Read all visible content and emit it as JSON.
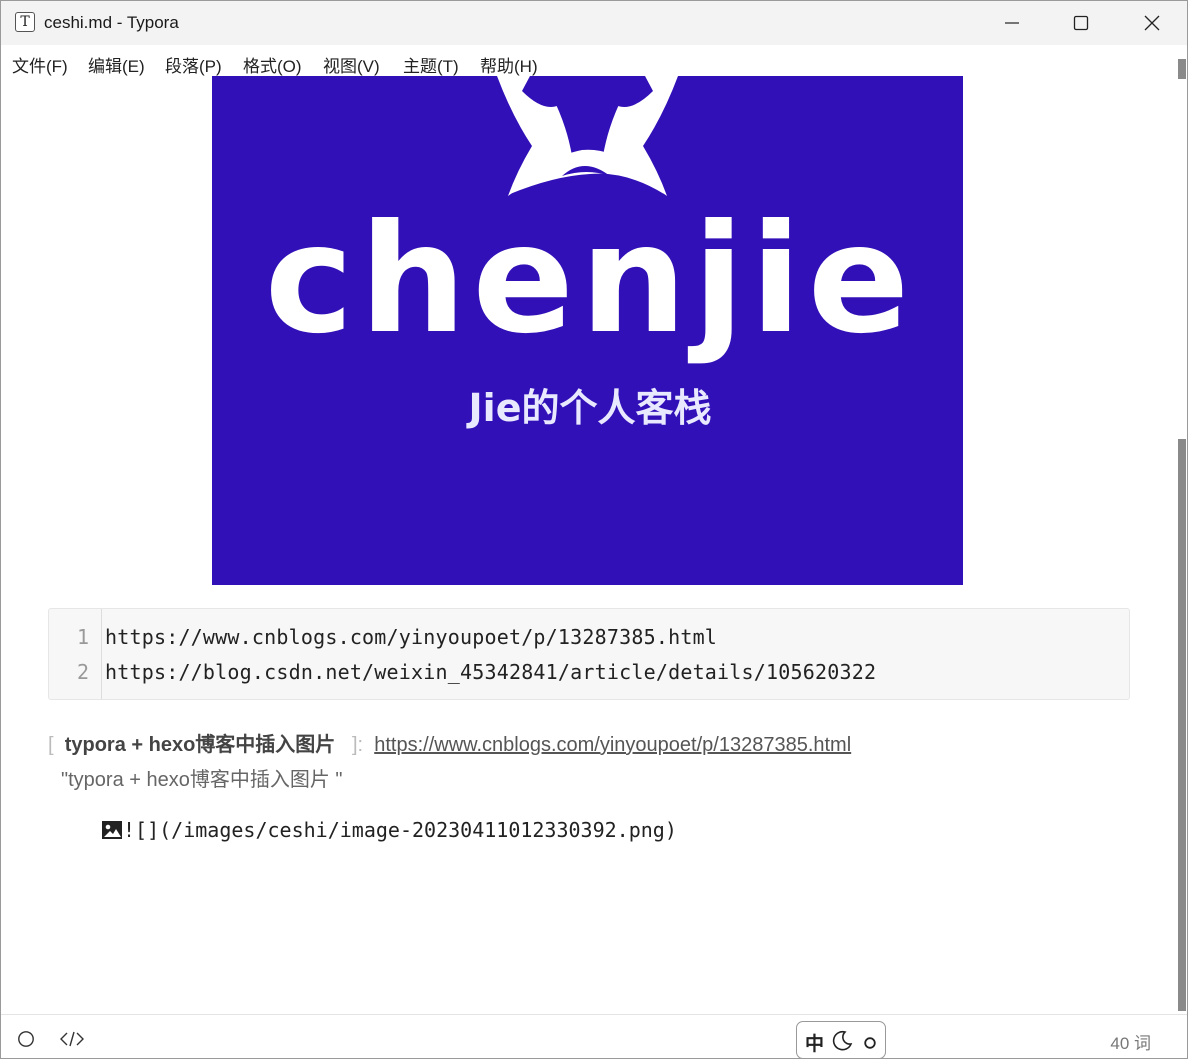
{
  "window": {
    "title": "ceshi.md - Typora",
    "app_icon_letter": "T"
  },
  "menu": [
    "文件(F)",
    "编辑(E)",
    "段落(P)",
    "格式(O)",
    "视图(V)",
    "主题(T)",
    "帮助(H)"
  ],
  "banner": {
    "logo_text": "chenjie",
    "subtitle": "Jie的个人客栈",
    "background_color": "#3210b8"
  },
  "code_block": {
    "lines": [
      {
        "number": "1",
        "text": "https://www.cnblogs.com/yinyoupoet/p/13287385.html"
      },
      {
        "number": "2",
        "text": "https://blog.csdn.net/weixin_45342841/article/details/105620322"
      }
    ]
  },
  "link_reference": {
    "open_bracket": "[",
    "label": "typora + hexo博客中插入图片",
    "close_bracket": "]:",
    "url": "https://www.cnblogs.com/yinyoupoet/p/13287385.html",
    "title": "\"typora + hexo博客中插入图片 \""
  },
  "image_markdown": "![](/images/ceshi/image-20230411012330392.png)",
  "status": {
    "ime_char": "中",
    "word_count": "40 词"
  }
}
